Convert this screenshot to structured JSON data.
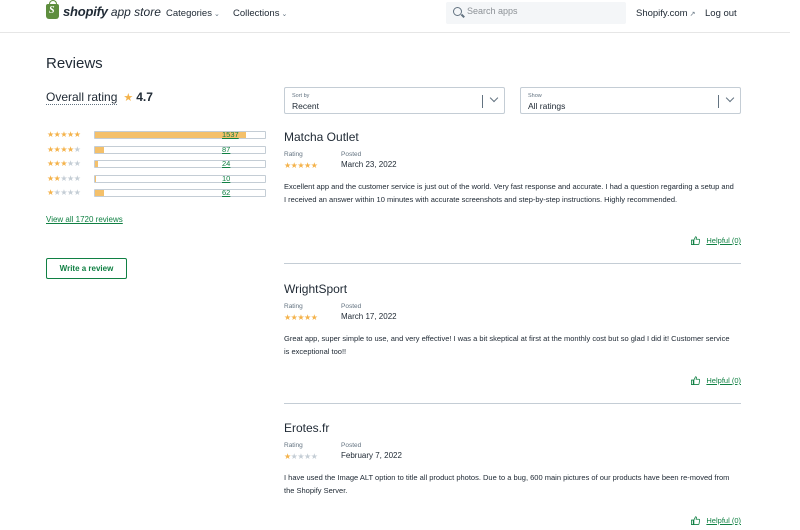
{
  "header": {
    "logo_brand": "shopify",
    "logo_sub": "app store",
    "nav": [
      {
        "label": "Categories"
      },
      {
        "label": "Collections"
      }
    ],
    "search_placeholder": "Search apps",
    "shopify_link": "Shopify.com",
    "logout": "Log out"
  },
  "summary": {
    "title": "Reviews",
    "overall_label": "Overall rating",
    "overall_value": "4.7",
    "distribution": [
      {
        "stars": 5,
        "count": "1537",
        "fraction": 0.89
      },
      {
        "stars": 4,
        "count": "87",
        "fraction": 0.05
      },
      {
        "stars": 3,
        "count": "24",
        "fraction": 0.015
      },
      {
        "stars": 2,
        "count": "10",
        "fraction": 0.008
      },
      {
        "stars": 1,
        "count": "62",
        "fraction": 0.05
      }
    ],
    "view_all": "View all 1720 reviews",
    "write_review": "Write a review"
  },
  "filters": {
    "sort_caption": "Sort by",
    "sort_value": "Recent",
    "show_caption": "Show",
    "show_value": "All ratings"
  },
  "labels": {
    "rating": "Rating",
    "posted": "Posted"
  },
  "reviews": [
    {
      "name": "Matcha Outlet",
      "rating": 5,
      "date": "March 23, 2022",
      "body": "Excellent app and the customer service is just out of the world. Very fast response and accurate. I had a question regarding a setup and I received an answer within 10 minutes with accurate screenshots and step-by-step instructions. Highly recommended.",
      "helpful": "Helpful (0)"
    },
    {
      "name": "WrightSport",
      "rating": 5,
      "date": "March 17, 2022",
      "body": "Great app, super simple to use, and very effective! I was a bit skeptical at first at the monthly cost but so glad I did it! Customer service is exceptional too!!",
      "helpful": "Helpful (0)"
    },
    {
      "name": "Erotes.fr",
      "rating": 1,
      "date": "February 7, 2022",
      "body": "I have used the Image ALT option to title all product photos. Due to a bug, 600 main pictures of our products have been re-moved from the Shopify Server.",
      "helpful": "Helpful (0)"
    }
  ],
  "colors": {
    "accent": "#108043",
    "star": "#f4b24a",
    "bar_fill": "#f4c06a"
  }
}
